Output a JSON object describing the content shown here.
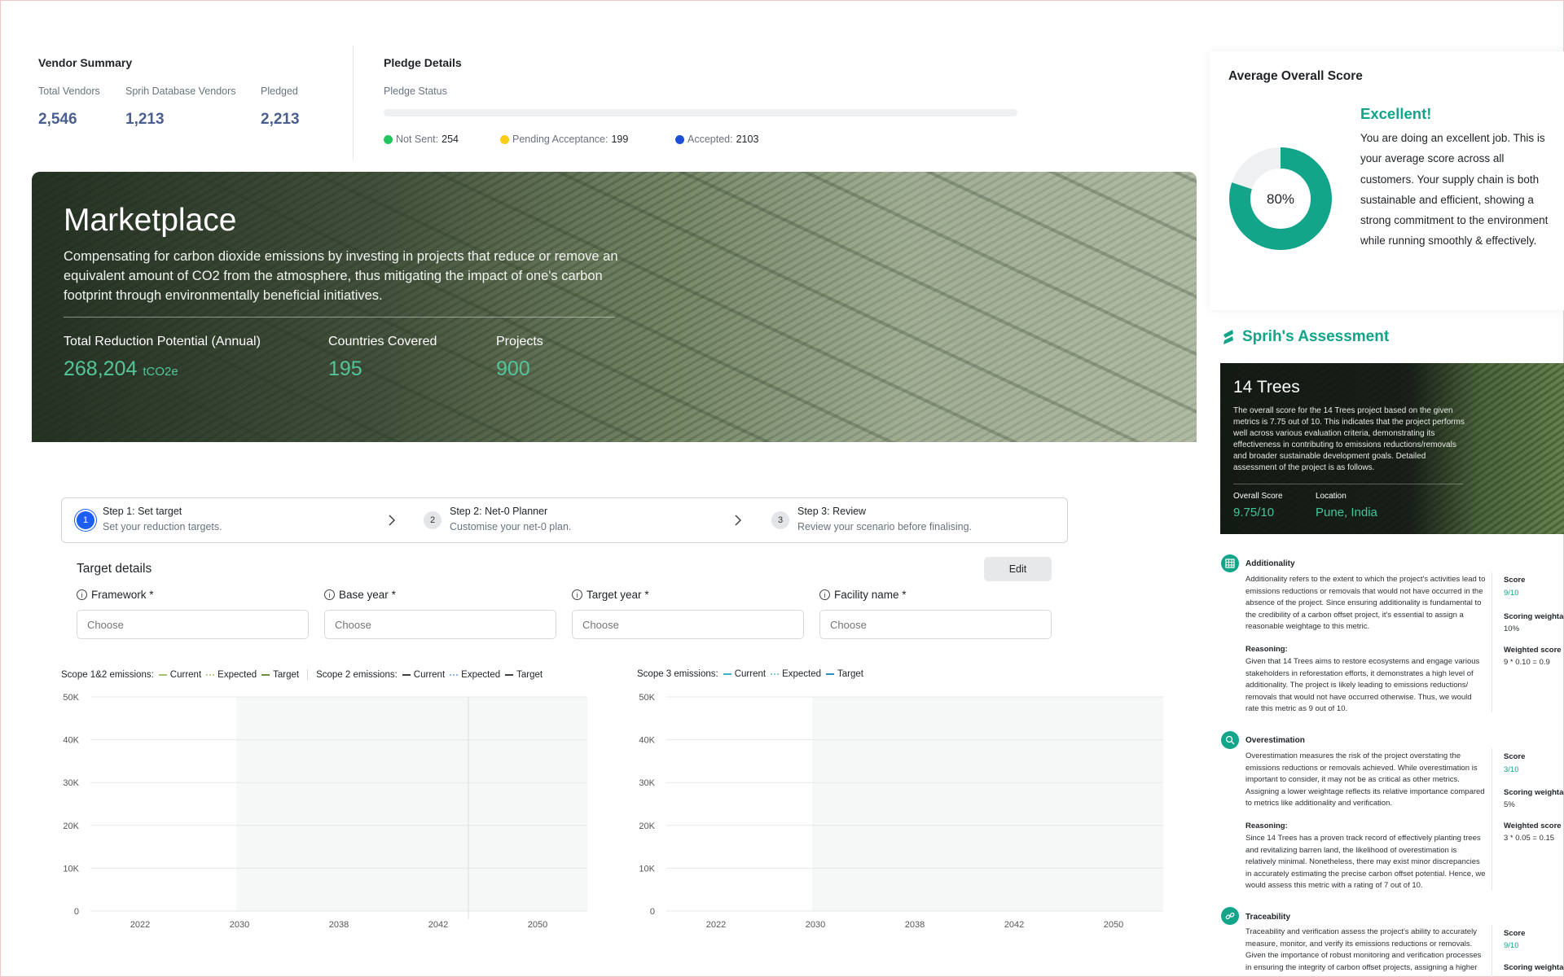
{
  "vendor_summary": {
    "title": "Vendor Summary",
    "stats": [
      {
        "label": "Total Vendors",
        "value": "2,546"
      },
      {
        "label": "Sprih Database Vendors",
        "value": "1,213"
      },
      {
        "label": "Pledged",
        "value": "2,213"
      }
    ]
  },
  "pledge_details": {
    "title": "Pledge Details",
    "status_label": "Pledge Status",
    "legend": [
      {
        "label": "Not Sent:",
        "value": "254",
        "color": "#22c55e"
      },
      {
        "label": "Pending Acceptance:",
        "value": "199",
        "color": "#facc15"
      },
      {
        "label": "Accepted:",
        "value": "2103",
        "color": "#1d4ed8"
      }
    ]
  },
  "marketplace": {
    "title": "Marketplace",
    "description": "Compensating for carbon dioxide emissions by investing in projects that reduce or remove an equivalent amount of CO2 from the atmosphere, thus mitigating the impact of one's carbon footprint through environmentally beneficial initiatives.",
    "stats": [
      {
        "label": "Total Reduction Potential (Annual)",
        "value": "268,204",
        "unit": "tCO2e"
      },
      {
        "label": "Countries Covered",
        "value": "195"
      },
      {
        "label": "Projects",
        "value": "900"
      }
    ]
  },
  "stepper": {
    "steps": [
      {
        "num": "1",
        "title": "Step 1: Set target",
        "subtitle": "Set your reduction targets."
      },
      {
        "num": "2",
        "title": "Step 2: Net-0 Planner",
        "subtitle": "Customise your net-0 plan."
      },
      {
        "num": "3",
        "title": "Step 3: Review",
        "subtitle": "Review your scenario before finalising."
      }
    ]
  },
  "target_details": {
    "title": "Target details",
    "edit_label": "Edit",
    "fields": [
      {
        "label": "Framework",
        "required": "*",
        "placeholder": "Choose"
      },
      {
        "label": "Base year",
        "required": "*",
        "placeholder": "Choose"
      },
      {
        "label": "Target year",
        "required": "*",
        "placeholder": "Choose"
      },
      {
        "label": "Facility name",
        "required": "*",
        "placeholder": "Choose"
      }
    ]
  },
  "chart_legends": {
    "scope12": {
      "title": "Scope 1&2 emissions:",
      "items": [
        "Current",
        "Expected",
        "Target"
      ],
      "colors": [
        "#a3c46a",
        "#b6cf8c",
        "#6b8f3a"
      ]
    },
    "scope2": {
      "title": "Scope 2 emissions:",
      "items": [
        "Current",
        "Expected",
        "Target"
      ],
      "colors": [
        "#3b3f44",
        "#8fb3e6",
        "#3b3f44"
      ]
    },
    "scope3": {
      "title": "Scope 3 emissions:",
      "items": [
        "Current",
        "Expected",
        "Target"
      ],
      "colors": [
        "#3ab3c7",
        "#7ccfdc",
        "#2a8fbf"
      ]
    }
  },
  "chart_data": [
    {
      "type": "line",
      "title": "Scope 1&2 / Scope 2 emissions",
      "xlabel": "",
      "ylabel": "",
      "x_ticks": [
        "2022",
        "2030",
        "2038",
        "2042",
        "2050"
      ],
      "y_ticks": [
        "0",
        "10K",
        "20K",
        "30K",
        "40K",
        "50K"
      ],
      "ylim": [
        0,
        50000
      ],
      "series": [],
      "grid": true,
      "shaded_region": [
        "2030",
        "2050"
      ]
    },
    {
      "type": "line",
      "title": "Scope 3 emissions",
      "xlabel": "",
      "ylabel": "",
      "x_ticks": [
        "2022",
        "2030",
        "2038",
        "2042",
        "2050"
      ],
      "y_ticks": [
        "0",
        "10K",
        "20K",
        "30K",
        "40K",
        "50K"
      ],
      "ylim": [
        0,
        50000
      ],
      "series": [],
      "grid": true,
      "shaded_region": [
        "2030",
        "2050"
      ]
    }
  ],
  "score_card": {
    "title": "Average Overall Score",
    "percent": "80%",
    "percent_value": 0.8,
    "heading": "Excellent!",
    "text": "You are doing an excellent job. This is your average score across all customers. Your supply chain is both sustainable and efficient, showing a strong commitment to the environment while running smoothly & effectively.",
    "accent": "#12a58a"
  },
  "assessment": {
    "title": "Sprih's Assessment",
    "project": {
      "name": "14 Trees",
      "description": "The overall score for the 14 Trees project based on the given metrics is 7.75 out of 10. This indicates that the project performs well across various evaluation criteria, demonstrating its effectiveness in contributing to emissions reductions/removals and broader sustainable development goals. Detailed assessment of the project is as follows.",
      "overall_label": "Overall Score",
      "overall_value": "9.75/10",
      "location_label": "Location",
      "location_value": "Pune, India"
    },
    "metrics": [
      {
        "name": "Additionality",
        "text": "Additionality refers to the extent to which the project's activities lead to emissions reductions or removals that would not have occurred in the absence of the project. Since ensuring additionality is fundamental to the credibility of a carbon offset project, it's essential to assign a reasonable weightage to this metric.",
        "reasoning_label": "Reasoning:",
        "reasoning": "Given that 14 Trees aims to restore ecosystems and engage various stakeholders in reforestation efforts, it demonstrates a high level of additionality. The project is likely leading to emissions reductions/ removals that would not have occurred otherwise. Thus, we would rate this metric as 9 out of 10.",
        "score_label": "Score",
        "score": "9/10",
        "weightage_label": "Scoring weightage",
        "weightage": "10%",
        "weighted_label": "Weighted score",
        "weighted": "9 * 0.10 = 0.9"
      },
      {
        "name": "Overestimation",
        "text": "Overestimation measures the risk of the project overstating the emissions reductions or removals achieved. While overestimation is important to consider, it may not be as critical as other metrics. Assigning a lower weightage reflects its relative importance compared to metrics like additionality and verification.",
        "reasoning_label": "Reasoning:",
        "reasoning": "Since 14 Trees has a proven track record of effectively planting trees and revitalizing barren land, the likelihood of overestimation is relatively minimal. Nonetheless, there may exist minor discrepancies in accurately estimating the precise carbon offset potential. Hence, we would assess this metric with a rating of 7 out of 10.",
        "score_label": "Score",
        "score": "3/10",
        "weightage_label": "Scoring weightage",
        "weightage": "5%",
        "weighted_label": "Weighted score",
        "weighted": "3 * 0.05 = 0.15"
      },
      {
        "name": "Traceability",
        "text": "Traceability and verification assess the project's ability to accurately measure, monitor, and verify its emissions reductions or removals. Given the importance of robust monitoring and verification processes in ensuring the integrity of carbon offset projects, assigning a higher",
        "score_label": "Score",
        "score": "9/10",
        "weightage_label": "Scoring weightage"
      }
    ]
  }
}
